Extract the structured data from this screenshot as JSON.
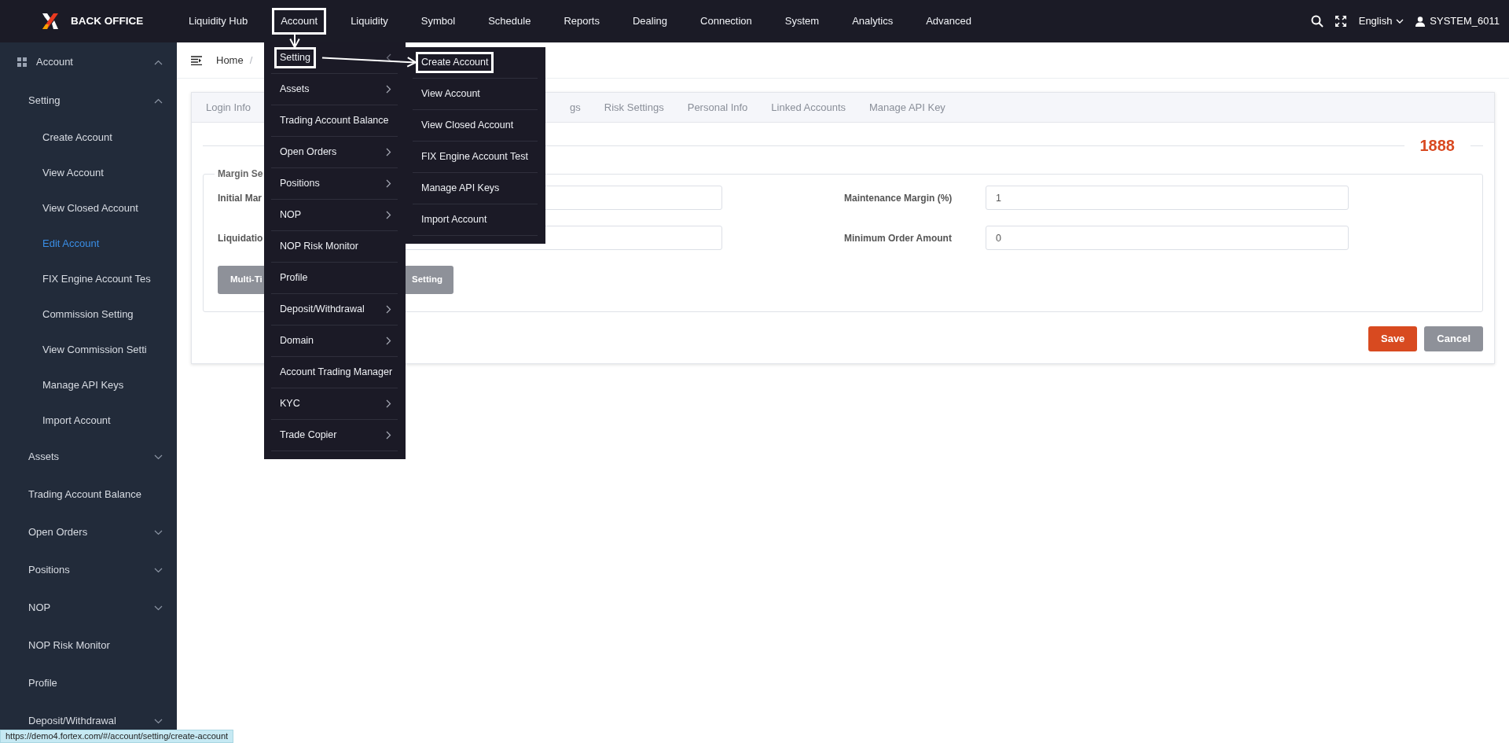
{
  "topbar": {
    "brand": "BACK OFFICE",
    "nav": [
      {
        "label": "Liquidity Hub",
        "annotated": false
      },
      {
        "label": "Account",
        "annotated": true
      },
      {
        "label": "Liquidity",
        "annotated": false
      },
      {
        "label": "Symbol",
        "annotated": false
      },
      {
        "label": "Schedule",
        "annotated": false
      },
      {
        "label": "Reports",
        "annotated": false
      },
      {
        "label": "Dealing",
        "annotated": false
      },
      {
        "label": "Connection",
        "annotated": false
      },
      {
        "label": "System",
        "annotated": false
      },
      {
        "label": "Analytics",
        "annotated": false
      },
      {
        "label": "Advanced",
        "annotated": false
      }
    ],
    "language": "English",
    "user": "SYSTEM_6011"
  },
  "sidebar": {
    "items": [
      {
        "label": "Account",
        "expanded": true,
        "selected": false,
        "children": [
          {
            "label": "Setting",
            "expanded": true,
            "selected": false,
            "children": [
              {
                "label": "Create Account",
                "selected": false
              },
              {
                "label": "View Account",
                "selected": false
              },
              {
                "label": "View Closed Account",
                "selected": false
              },
              {
                "label": "Edit Account",
                "selected": true
              },
              {
                "label": "FIX Engine Account Tes",
                "selected": false
              },
              {
                "label": "Commission Setting",
                "selected": false
              },
              {
                "label": "View Commission Setti",
                "selected": false
              },
              {
                "label": "Manage API Keys",
                "selected": false
              },
              {
                "label": "Import Account",
                "selected": false
              }
            ]
          },
          {
            "label": "Assets",
            "expanded": false,
            "selected": false
          },
          {
            "label": "Trading Account Balance",
            "selected": false
          },
          {
            "label": "Open Orders",
            "expanded": false,
            "selected": false
          },
          {
            "label": "Positions",
            "expanded": false,
            "selected": false
          },
          {
            "label": "NOP",
            "expanded": false,
            "selected": false
          },
          {
            "label": "NOP Risk Monitor",
            "selected": false
          },
          {
            "label": "Profile",
            "selected": false
          },
          {
            "label": "Deposit/Withdrawal",
            "expanded": false,
            "selected": false
          }
        ]
      }
    ]
  },
  "breadcrumb": {
    "items": [
      "Home"
    ],
    "separator": "/"
  },
  "tabs": [
    {
      "label": "Login Info"
    },
    {
      "label": "gs"
    },
    {
      "label": "Risk Settings"
    },
    {
      "label": "Personal Info"
    },
    {
      "label": "Linked Accounts"
    },
    {
      "label": "Manage API Key"
    }
  ],
  "account_number": "1888",
  "margin_section": {
    "legend": "Margin Se",
    "fields": [
      {
        "label": "Initial Mar"
      },
      {
        "label": "Maintenance Margin (%)",
        "value": "1"
      },
      {
        "label": "Liquidatio"
      },
      {
        "label": "Minimum Order Amount",
        "value": "0"
      }
    ],
    "button": {
      "label_start": "Multi-Ti",
      "label_end": "Setting"
    }
  },
  "actions": [
    {
      "label": "Save",
      "kind": "primary"
    },
    {
      "label": "Cancel",
      "kind": "secondary"
    }
  ],
  "account_menu": {
    "items": [
      {
        "label": "Setting",
        "expanded": true,
        "annotated": true
      },
      {
        "label": "Assets",
        "expanded": false,
        "annotated": false
      },
      {
        "label": "Trading Account Balance",
        "annotated": false
      },
      {
        "label": "Open Orders",
        "expanded": false,
        "annotated": false
      },
      {
        "label": "Positions",
        "expanded": false,
        "annotated": false
      },
      {
        "label": "NOP",
        "expanded": false,
        "annotated": false
      },
      {
        "label": "NOP Risk Monitor",
        "annotated": false
      },
      {
        "label": "Profile",
        "annotated": false
      },
      {
        "label": "Deposit/Withdrawal",
        "expanded": false,
        "annotated": false
      },
      {
        "label": "Domain",
        "expanded": false,
        "annotated": false
      },
      {
        "label": "Account Trading Manager",
        "annotated": false
      },
      {
        "label": "KYC",
        "expanded": false,
        "annotated": false
      },
      {
        "label": "Trade Copier",
        "expanded": false,
        "annotated": false
      }
    ]
  },
  "setting_submenu": {
    "items": [
      {
        "label": "Create Account",
        "annotated": true
      },
      {
        "label": "View Account",
        "annotated": false
      },
      {
        "label": "View Closed Account",
        "annotated": false
      },
      {
        "label": "FIX Engine Account Test",
        "annotated": false
      },
      {
        "label": "Manage API Keys",
        "annotated": false
      },
      {
        "label": "Import Account",
        "annotated": false
      }
    ]
  },
  "status_url": "https://demo4.fortex.com/#/account/setting/create-account"
}
